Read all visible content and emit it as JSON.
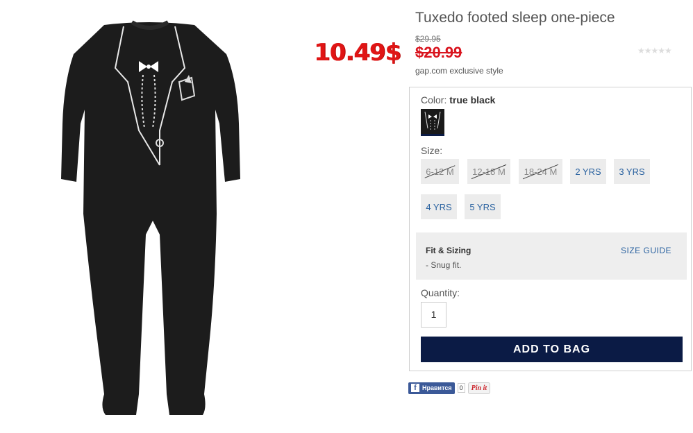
{
  "product": {
    "title": "Tuxedo footed sleep one-piece",
    "old_price": "$29.95",
    "sale_price": "$20.99",
    "promo_price": "10.49$",
    "exclusive": "gap.com exclusive style",
    "rating_stars": "★★★★★"
  },
  "color": {
    "label": "Color:",
    "value": "true black"
  },
  "sizes": {
    "label": "Size:",
    "options": [
      {
        "label": "6-12 M",
        "available": false
      },
      {
        "label": "12-18 M",
        "available": false
      },
      {
        "label": "18-24 M",
        "available": false
      },
      {
        "label": "2 YRS",
        "available": true
      },
      {
        "label": "3 YRS",
        "available": true
      },
      {
        "label": "4 YRS",
        "available": true
      },
      {
        "label": "5 YRS",
        "available": true
      }
    ]
  },
  "fit": {
    "title": "Fit & Sizing",
    "description": "- Snug fit.",
    "size_guide": "SIZE GUIDE"
  },
  "quantity": {
    "label": "Quantity:",
    "value": "1"
  },
  "add_to_bag": "ADD TO BAG",
  "social": {
    "fb_icon": "f",
    "fb_like": "Нравится",
    "fb_count": "0",
    "pin_it": "Pin it"
  },
  "colors": {
    "navy": "#0b1b45",
    "sale_red": "#d9141e",
    "link_blue": "#2a62a0"
  }
}
